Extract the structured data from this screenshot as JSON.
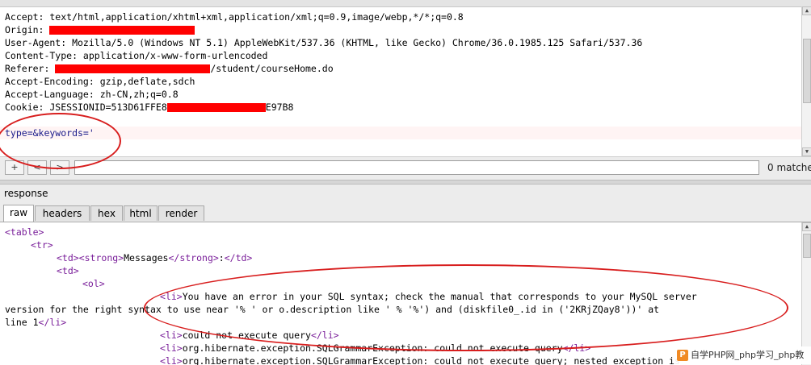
{
  "request": {
    "lines": {
      "accept": "Accept: text/html,application/xhtml+xml,application/xml;q=0.9,image/webp,*/*;q=0.8",
      "origin_key": "Origin: ",
      "user_agent": "User-Agent: Mozilla/5.0 (Windows NT 5.1) AppleWebKit/537.36 (KHTML, like Gecko) Chrome/36.0.1985.125 Safari/537.36",
      "content_type": "Content-Type: application/x-www-form-urlencoded",
      "referer_key": "Referer: ",
      "referer_tail": "/student/courseHome.do",
      "accept_encoding": "Accept-Encoding: gzip,deflate,sdch",
      "accept_language": "Accept-Language: zh-CN,zh;q=0.8",
      "cookie_key": "Cookie: JSESSIONID=513D61FFE8",
      "cookie_tail": "E97B8",
      "body": "type=&keywords='"
    }
  },
  "search": {
    "add_label": "+",
    "prev_label": "<",
    "next_label": ">",
    "value": "",
    "matches": "0 matches"
  },
  "response": {
    "title": "response",
    "tabs": [
      {
        "label": "raw",
        "active": true
      },
      {
        "label": "headers",
        "active": false
      },
      {
        "label": "hex",
        "active": false
      },
      {
        "label": "html",
        "active": false
      },
      {
        "label": "render",
        "active": false
      }
    ],
    "code": {
      "table_open": "<table>",
      "tr_open": "<tr>",
      "td_open": "<td>",
      "strong_open": "<strong>",
      "messages": "Messages",
      "strong_close": "</strong>",
      "colon": ":",
      "td_close": "</td>",
      "ol_open": "<ol>",
      "li_open": "<li>",
      "li_close": "</li>",
      "error_line1": "You have an error in your SQL syntax; check the manual that corresponds to your MySQL server",
      "error_line2": "version for the right syntax to use near '% ' or o.description like ' % '%') and (diskfile0_.id in ('2KRjZQay8'))' at",
      "error_line3": "line 1",
      "could_not_execute": "could not execute query",
      "hibernate_1": "org.hibernate.exception.SQLGrammarException: could not execute query",
      "hibernate_2": "org.hibernate.exception.SQLGrammarException: could not execute query; nested exception is"
    }
  },
  "watermark": {
    "logo": "P",
    "text": "自学PHP网_php学习_php教"
  },
  "colors": {
    "tag": "#7a1f9a",
    "annotation": "#d81e1e",
    "redaction": "#ff0000"
  }
}
